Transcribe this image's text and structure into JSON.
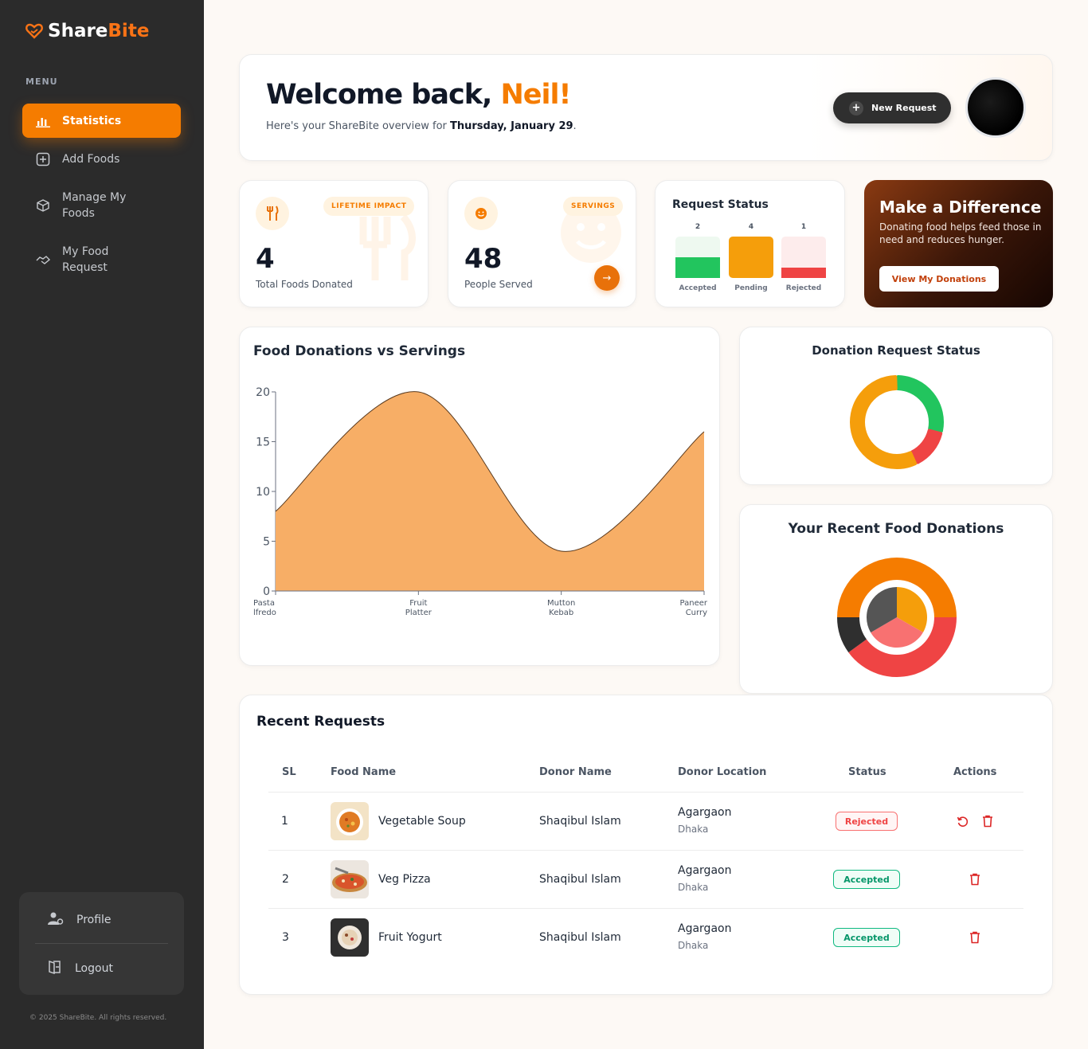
{
  "brand": {
    "part1": "Share",
    "part2": "Bite"
  },
  "sidebar": {
    "menu_label": "MENU",
    "items": [
      {
        "label": "Statistics",
        "icon": "bar-chart-icon",
        "active": true
      },
      {
        "label": "Add Foods",
        "icon": "plus-square-icon"
      },
      {
        "label": "Manage My Foods",
        "icon": "box-gear-icon"
      },
      {
        "label": "My Food Request",
        "icon": "handshake-icon"
      }
    ],
    "profile_label": "Profile",
    "logout_label": "Logout",
    "copyright": "© 2025 ShareBite. All rights reserved."
  },
  "welcome": {
    "greeting": "Welcome back, ",
    "name": "Neil!",
    "subtitle_prefix": "Here's your ShareBite overview for ",
    "date": "Thursday, January 29",
    "subtitle_suffix": ".",
    "new_request_label": "New Request"
  },
  "stats": {
    "lifetime": {
      "badge": "LIFETIME IMPACT",
      "value": "4",
      "label": "Total Foods Donated"
    },
    "servings": {
      "badge": "SERVINGS",
      "value": "48",
      "label": "People Served"
    }
  },
  "request_status": {
    "title": "Request Status",
    "bars": [
      {
        "label": "Accepted",
        "count": "2",
        "fill": 0.5,
        "color": "#22c55e"
      },
      {
        "label": "Pending",
        "count": "4",
        "fill": 1.0,
        "color": "#f59e0b"
      },
      {
        "label": "Rejected",
        "count": "1",
        "fill": 0.25,
        "color": "#ef4444"
      }
    ]
  },
  "promo": {
    "title": "Make a Difference",
    "description": "Donating food helps feed those in need and reduces hunger.",
    "button_label": "View My Donations"
  },
  "chart_data": [
    {
      "type": "area",
      "title": "Food Donations vs Servings",
      "categories": [
        "Pasta Alfredo",
        "Fruit Platter",
        "Mutton Kebab",
        "Paneer Curry"
      ],
      "category_lines": [
        [
          "Pasta",
          "lfredo"
        ],
        [
          "Fruit",
          "Platter"
        ],
        [
          "Mutton",
          "Kebab"
        ],
        [
          "Paneer",
          "Curry"
        ]
      ],
      "values": [
        8,
        20,
        4,
        16
      ],
      "ylim": [
        0,
        20
      ],
      "yticks": [
        0,
        5,
        10,
        15,
        20
      ],
      "color": "#f7ae66"
    },
    {
      "type": "pie",
      "title": "Donation Request Status",
      "labels": [
        "Accepted",
        "Rejected",
        "Pending"
      ],
      "values": [
        2,
        1,
        4
      ],
      "colors": [
        "#22c55e",
        "#ef4444",
        "#f59e0b"
      ]
    },
    {
      "type": "pie",
      "title": "Your Recent Food Donations",
      "outer_values": [
        50,
        40,
        10
      ],
      "outer_colors": [
        "#f57c00",
        "#ef4444",
        "#2f2f2f"
      ],
      "inner_values": [
        33.3,
        33.3,
        33.4
      ],
      "inner_colors": [
        "#f59e0b",
        "#f87171",
        "#555555"
      ]
    }
  ],
  "recent_requests": {
    "title": "Recent Requests",
    "headers": [
      "SL",
      "Food Name",
      "Donor Name",
      "Donor Location",
      "Status",
      "Actions"
    ],
    "rows": [
      {
        "sl": "1",
        "food": "Vegetable Soup",
        "donor": "Shaqibul Islam",
        "location": "Agargaon",
        "city": "Dhaka",
        "status": "Rejected"
      },
      {
        "sl": "2",
        "food": "Veg Pizza",
        "donor": "Shaqibul Islam",
        "location": "Agargaon",
        "city": "Dhaka",
        "status": "Accepted"
      },
      {
        "sl": "3",
        "food": "Fruit Yogurt",
        "donor": "Shaqibul Islam",
        "location": "Agargaon",
        "city": "Dhaka",
        "status": "Accepted"
      }
    ]
  }
}
